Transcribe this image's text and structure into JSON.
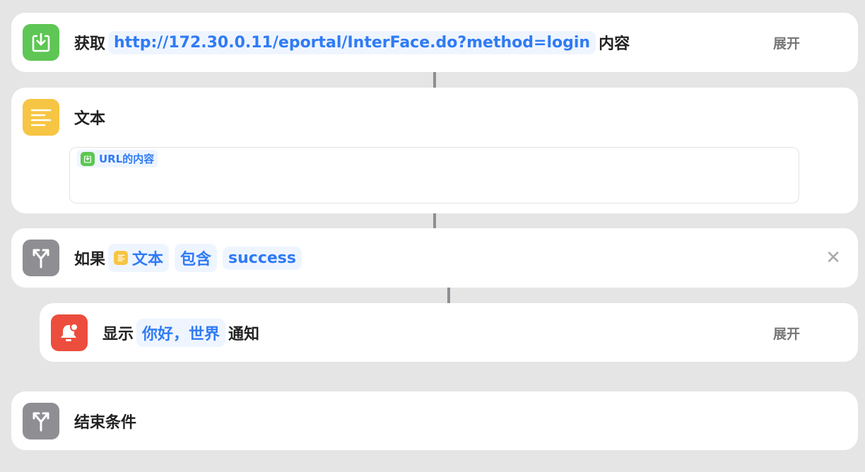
{
  "colors": {
    "background": "#e5e5e5",
    "accent": "#2f7bf5",
    "get_icon": "#5ec654",
    "text_icon": "#f7c544",
    "if_icon": "#8e8e93",
    "notify_icon": "#ec4d3d"
  },
  "actions": [
    {
      "icon": "download-icon",
      "title": "获取",
      "token": "http://172.30.0.11/eportal/InterFace.do?method=login",
      "tail": "内容",
      "expand": "展开"
    },
    {
      "icon": "text-lines-icon",
      "title": "文本",
      "variable": "URL的内容"
    },
    {
      "icon": "branch-icon",
      "title": "如果",
      "tokens": [
        "文本",
        "包含",
        "success"
      ]
    },
    {
      "icon": "bell-icon",
      "title": "显示",
      "token": "你好，世界",
      "tail": "通知",
      "expand": "展开"
    },
    {
      "icon": "branch-icon",
      "title": "结束条件"
    }
  ]
}
